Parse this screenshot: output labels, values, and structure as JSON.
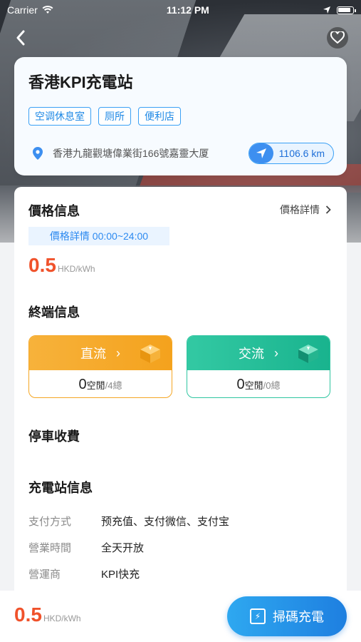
{
  "status_bar": {
    "carrier": "Carrier",
    "time": "11:12 PM",
    "battery_level": 0.9
  },
  "station": {
    "name": "香港KPI充電站",
    "tags": [
      "空调休息室",
      "厕所",
      "便利店"
    ],
    "address": "香港九龍觀塘偉業街166號嘉靈大厦",
    "distance": "1106.6 km"
  },
  "price_info": {
    "title": "價格信息",
    "detail_link": "價格詳情",
    "time_badge": "價格詳情 00:00~24:00",
    "price": "0.5",
    "unit": "HKD/kWh"
  },
  "terminal_info": {
    "title": "終端信息",
    "dc": {
      "label": "直流",
      "free": "0",
      "free_label": "空閒",
      "total": "/4總"
    },
    "ac": {
      "label": "交流",
      "free": "0",
      "free_label": "空閒",
      "total": "/0總"
    }
  },
  "parking": {
    "title": "停車收費"
  },
  "station_info": {
    "title": "充電站信息",
    "rows": [
      {
        "key": "支付方式",
        "value": "预充值、支付微信、支付宝"
      },
      {
        "key": "營業時間",
        "value": "全天开放"
      },
      {
        "key": "營運商",
        "value": "KPI快充"
      }
    ]
  },
  "bottom_bar": {
    "price": "0.5",
    "unit": "HKD/kWh",
    "scan_label": "掃碼充電"
  },
  "colors": {
    "accent_blue": "#2d8af0",
    "price_orange": "#f0522b",
    "dc_orange": "#f5a623",
    "ac_green": "#2ec5a0"
  }
}
